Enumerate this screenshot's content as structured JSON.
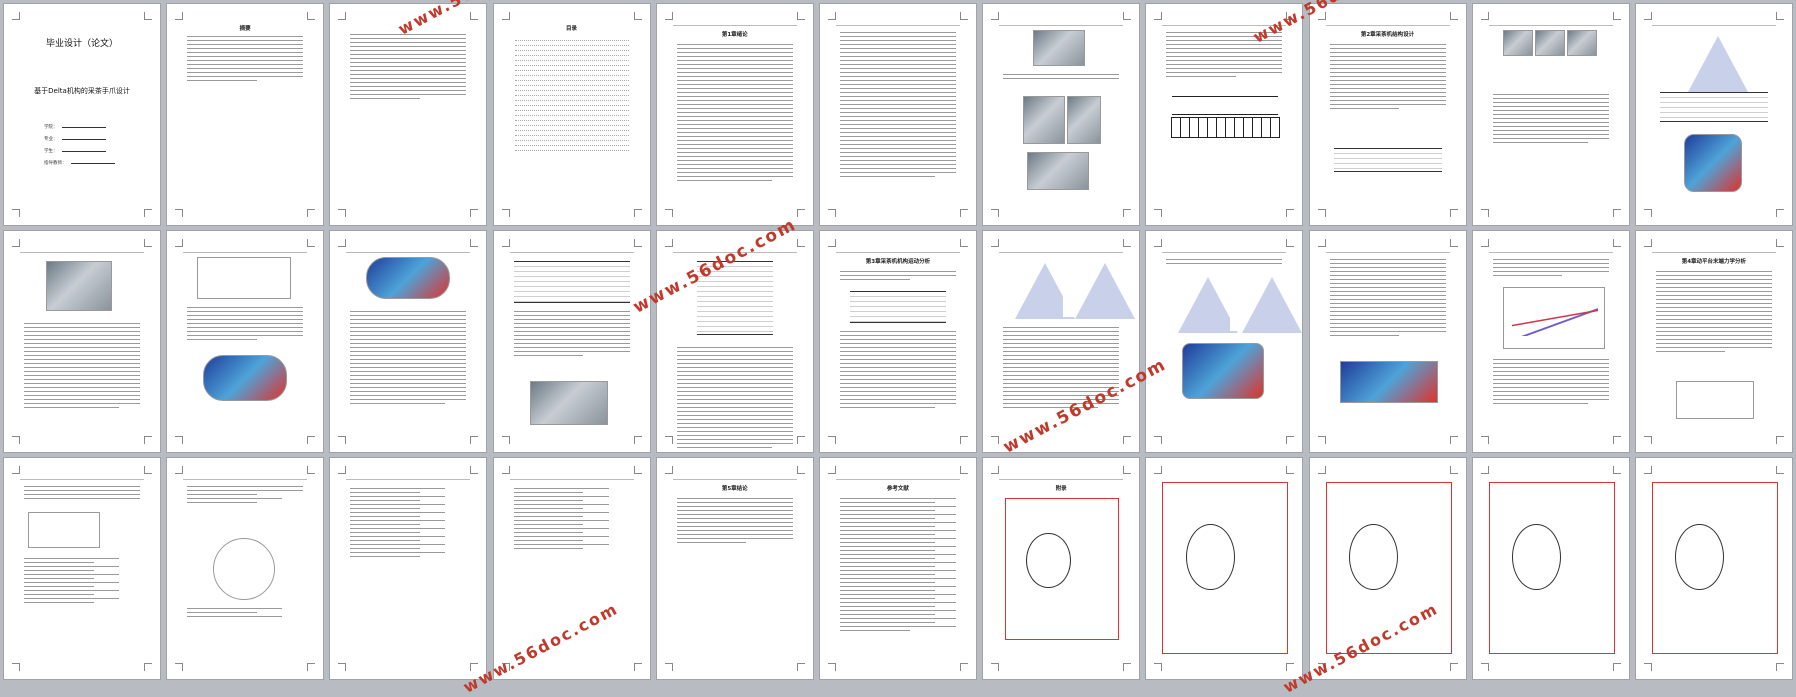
{
  "thesis": {
    "cover_title": "毕业设计（论文）",
    "cover_subtitle": "基于Delta机构的采茶手爪设计",
    "cover_fields": [
      "学院：",
      "专业：",
      "学生：",
      "指导教师："
    ],
    "abstract_title": "摘要",
    "toc_title": "目录",
    "chapter1_title": "第1章绪论",
    "chapter2_title": "第2章采茶机结构设计",
    "chapter3_title": "第3章采茶机机构运动分析",
    "chapter4_title": "第4章动平台末端力学分析",
    "chapter5_title": "第5章结论",
    "references_title": "参考文献",
    "appendix_title": "附录"
  },
  "watermark": {
    "text": "www.56doc.com",
    "color": "#c0392b"
  }
}
